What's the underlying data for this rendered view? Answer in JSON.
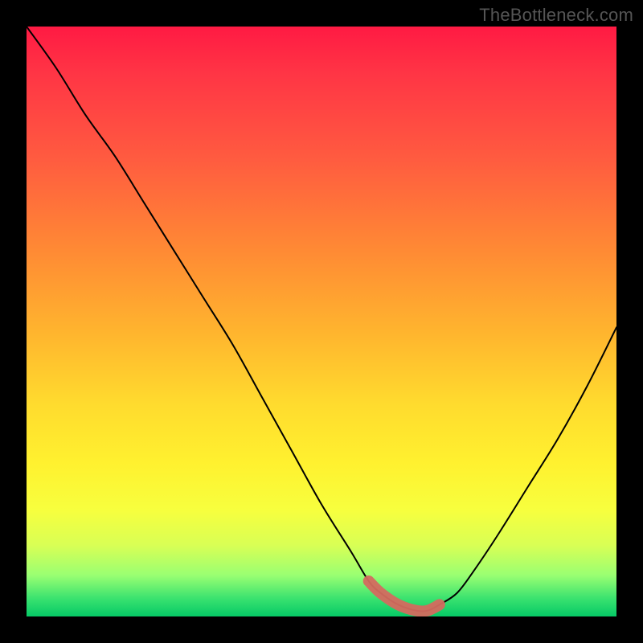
{
  "watermark": "TheBottleneck.com",
  "chart_data": {
    "type": "line",
    "title": "",
    "xlabel": "",
    "ylabel": "",
    "xlim": [
      0,
      100
    ],
    "ylim": [
      0,
      100
    ],
    "x": [
      0,
      5,
      10,
      15,
      20,
      25,
      30,
      35,
      40,
      45,
      50,
      55,
      58,
      60,
      63,
      66,
      68,
      70,
      73,
      76,
      80,
      85,
      90,
      95,
      100
    ],
    "values": [
      100,
      93,
      85,
      78,
      70,
      62,
      54,
      46,
      37,
      28,
      19,
      11,
      6,
      4,
      2,
      1,
      1,
      2,
      4,
      8,
      14,
      22,
      30,
      39,
      49
    ],
    "annotations": [
      {
        "kind": "highlight-segment",
        "x_start": 58,
        "x_end": 70,
        "color": "#d46a5f",
        "note": "bottleneck minimum band"
      }
    ],
    "gradient_description": "vertical heat gradient red (top) to green (bottom)"
  }
}
